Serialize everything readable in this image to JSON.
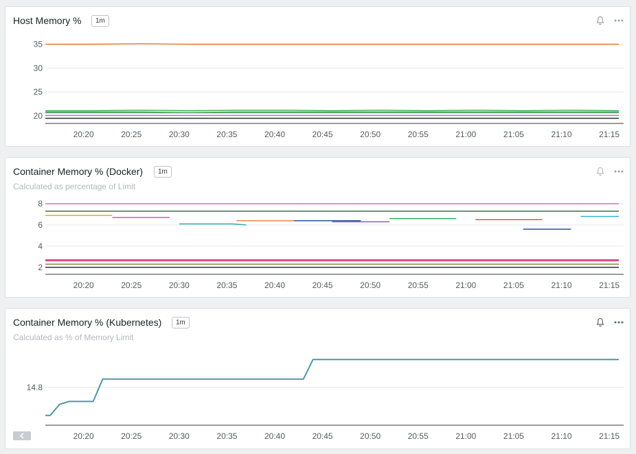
{
  "panels": [
    {
      "title": "Host Memory %",
      "badge": "1m",
      "subtitle": "",
      "notify_icon": "bell-icon",
      "menu_icon": "more-horizontal-icon"
    },
    {
      "title": "Container Memory % (Docker)",
      "badge": "1m",
      "subtitle": "Calculated as percentage of Limit",
      "notify_icon": "bell-icon",
      "menu_icon": "more-horizontal-icon"
    },
    {
      "title": "Container Memory % (Kubernetes)",
      "badge": "1m",
      "subtitle": "Calculated as % of Memory Limit",
      "notify_icon": "bell-icon",
      "menu_icon": "more-horizontal-icon",
      "collapse_icon": "chevron-left-icon"
    }
  ],
  "chart_data": [
    {
      "type": "line",
      "title": "Host Memory %",
      "x": [
        "20:20",
        "20:25",
        "20:30",
        "20:35",
        "20:40",
        "20:45",
        "20:50",
        "20:55",
        "21:00",
        "21:05",
        "21:10",
        "21:15"
      ],
      "x_range": [
        "20:16",
        "21:16"
      ],
      "ylim": [
        19,
        36.5
      ],
      "yticks": [
        20,
        25,
        30,
        35
      ],
      "grid": true,
      "series": [
        {
          "color": "#e8742a",
          "values": [
            35.0,
            35.0,
            35.1,
            35.0,
            35.0,
            35.0,
            35.0,
            35.0,
            35.0,
            35.0,
            35.0,
            35.0,
            35.0
          ]
        },
        {
          "color": "#2faa4b",
          "values": [
            21.1,
            21.1,
            21.2,
            21.1,
            21.2,
            21.2,
            21.1,
            21.2,
            21.1,
            21.2,
            21.1,
            21.2,
            21.1
          ]
        },
        {
          "color": "#1f7a3d",
          "values": [
            20.8,
            20.8,
            20.8,
            20.7,
            20.8,
            20.8,
            20.8,
            20.8,
            20.8,
            20.8,
            20.8,
            20.8,
            20.8
          ]
        },
        {
          "color": "#8fd19e",
          "values": [
            20.6,
            20.6,
            20.6,
            20.6,
            20.6,
            20.6,
            20.6,
            20.6,
            20.6,
            20.6,
            20.6,
            20.6,
            20.6
          ]
        },
        {
          "color": "#c66bd6",
          "values": [
            20.1,
            20.1,
            20.1,
            20.1,
            20.1,
            20.1,
            20.1,
            20.1,
            20.1,
            20.1,
            20.1,
            20.1,
            20.1
          ]
        },
        {
          "color": "#2a2f3a",
          "values": [
            19.5,
            19.5,
            19.5,
            19.5,
            19.5,
            19.5,
            19.5,
            19.5,
            19.5,
            19.5,
            19.5,
            19.5,
            19.5
          ]
        }
      ]
    },
    {
      "type": "line",
      "title": "Container Memory % (Docker)",
      "x": [
        "20:20",
        "20:25",
        "20:30",
        "20:35",
        "20:40",
        "20:45",
        "20:50",
        "20:55",
        "21:00",
        "21:05",
        "21:10",
        "21:15"
      ],
      "x_range": [
        "20:16",
        "21:16"
      ],
      "ylim": [
        1.6,
        8.2
      ],
      "yticks": [
        2,
        4,
        6,
        8
      ],
      "grid": true,
      "series": [
        {
          "color": "#e05ab0",
          "values": [
            8.0,
            8.0,
            8.0,
            8.0,
            8.0,
            8.0,
            8.0,
            8.0,
            8.0,
            8.0,
            8.0,
            8.0,
            8.0
          ]
        },
        {
          "color": "#2d5d3a",
          "values": [
            7.3,
            7.3,
            7.3,
            7.3,
            7.3,
            7.3,
            7.3,
            7.3,
            7.3,
            7.3,
            7.3,
            7.3,
            7.3
          ]
        },
        {
          "color": "#d6a020",
          "values": [
            6.9,
            6.9,
            6.9
          ]
        },
        {
          "color": "#e63f9a",
          "values": [
            6.7,
            6.7,
            6.7,
            6.7
          ]
        },
        {
          "color": "#2ab0b0",
          "values": [
            6.1,
            6.1,
            6.1,
            6.1,
            6.1,
            6.0
          ]
        },
        {
          "color": "#f07a3a",
          "values": [
            6.4,
            6.4,
            6.4,
            6.4
          ]
        },
        {
          "color": "#1b3f8a",
          "values": [
            6.4,
            6.4,
            6.4,
            6.4,
            6.4
          ]
        },
        {
          "color": "#7a50c8",
          "values": [
            6.3,
            6.3,
            6.3,
            6.3
          ]
        },
        {
          "color": "#1fae5a",
          "values": [
            6.6,
            6.6,
            6.6,
            6.6,
            6.6
          ]
        },
        {
          "color": "#c0504d",
          "values": [
            6.5,
            6.5,
            6.5,
            6.5,
            6.5,
            6.5
          ]
        },
        {
          "color": "#1c3f8a",
          "values": [
            5.6,
            5.6,
            5.6,
            5.6,
            5.6
          ]
        },
        {
          "color": "#2ab0d0",
          "values": [
            6.8,
            6.8,
            6.8,
            6.8,
            6.8,
            6.8
          ]
        },
        {
          "color": "#c81d64",
          "values": [
            2.7,
            2.7,
            2.7,
            2.7,
            2.7,
            2.7,
            2.7,
            2.7,
            2.7,
            2.7,
            2.7,
            2.7,
            2.7
          ]
        },
        {
          "color": "#e85aa0",
          "values": [
            2.6,
            2.6,
            2.6,
            2.6,
            2.6,
            2.6,
            2.6,
            2.6,
            2.6,
            2.6,
            2.6,
            2.6,
            2.6
          ]
        },
        {
          "color": "#7a7f2a",
          "values": [
            2.3,
            2.3,
            2.3,
            2.3,
            2.3,
            2.3,
            2.3,
            2.3,
            2.3,
            2.3,
            2.3,
            2.3,
            2.3
          ]
        },
        {
          "color": "#1a1f2a",
          "values": [
            2.0,
            2.0,
            2.0,
            2.0,
            2.0,
            2.0,
            2.0,
            2.0,
            2.0,
            2.0,
            2.0,
            2.0,
            2.0
          ]
        }
      ]
    },
    {
      "type": "line",
      "title": "Container Memory % (Kubernetes)",
      "x": [
        "20:20",
        "20:25",
        "20:30",
        "20:35",
        "20:40",
        "20:45",
        "20:50",
        "20:55",
        "21:00",
        "21:05",
        "21:10",
        "21:15"
      ],
      "x_range": [
        "20:16",
        "21:16"
      ],
      "ylim": [
        14.55,
        15.05
      ],
      "yticks": [
        14.8
      ],
      "grid": true,
      "series": [
        {
          "color": "#4a98a8",
          "points": [
            [
              "20:16",
              14.6
            ],
            [
              "20:16.5",
              14.6
            ],
            [
              "20:17.5",
              14.68
            ],
            [
              "20:18.5",
              14.7
            ],
            [
              "20:21",
              14.7
            ],
            [
              "20:22",
              14.86
            ],
            [
              "20:43",
              14.86
            ],
            [
              "20:44",
              15.0
            ],
            [
              "21:16",
              15.0
            ]
          ]
        }
      ]
    }
  ]
}
